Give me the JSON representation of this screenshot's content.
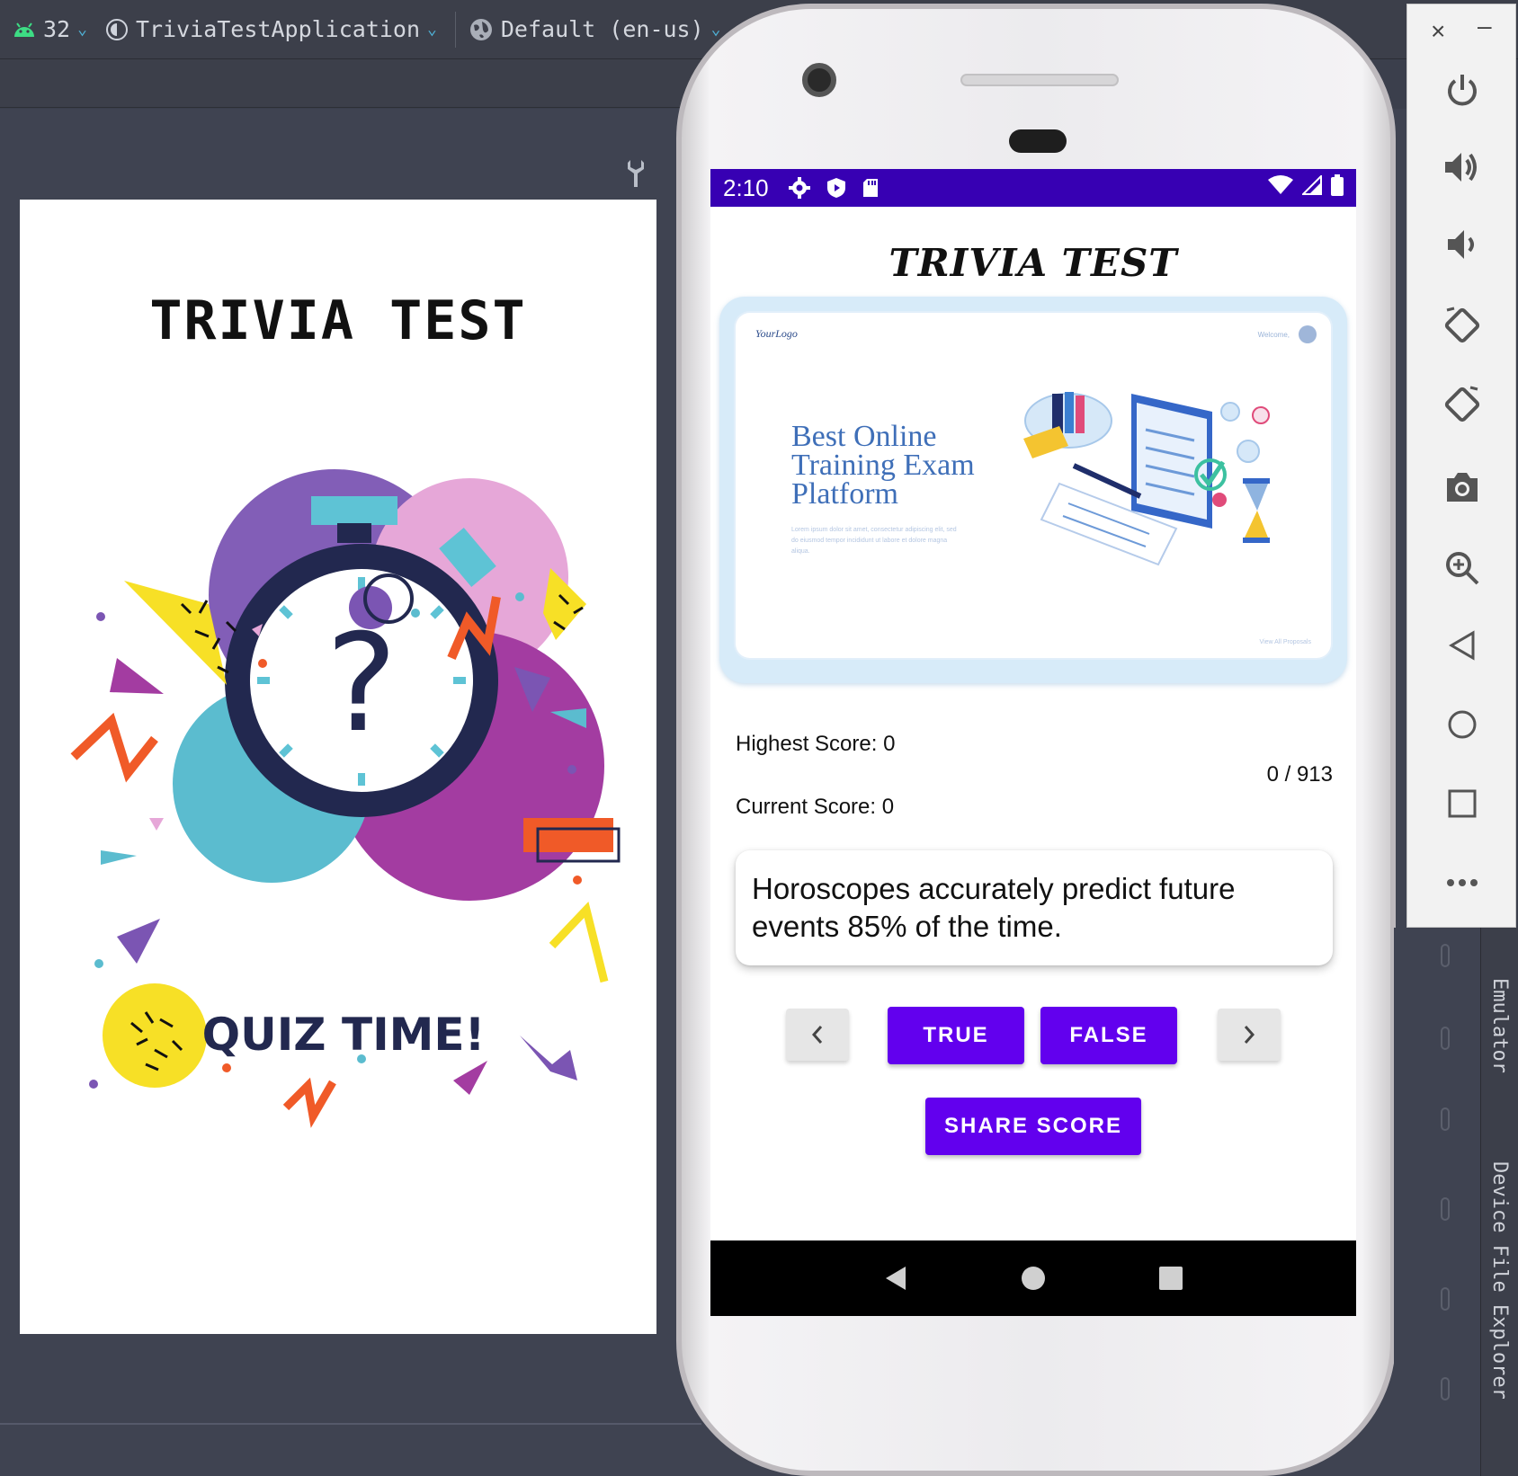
{
  "ide": {
    "api_level": "32",
    "app_config": "TriviaTestApplication",
    "locale": "Default (en-us)"
  },
  "preview": {
    "title": "TRIVIA TEST",
    "quiz_label": "QUIZ TIME!",
    "question_mark": "?"
  },
  "statusbar": {
    "time": "2:10"
  },
  "app": {
    "title": "TRIVIA TEST",
    "banner": {
      "logo": "YourLogo",
      "welcome": "Welcome,",
      "headline": "Best Online Training Exam Platform",
      "lorem": "Lorem ipsum dolor sit amet, consectetur adipiscing elit, sed do eiusmod tempor incididunt ut labore et dolore magna aliqua.",
      "footer": "View All Proposals"
    },
    "highest_score": "Highest Score: 0",
    "current_score": "Current Score: 0",
    "question_count": "0 / 913",
    "question_text": "Horoscopes accurately predict future events 85% of the time.",
    "btn_true": "TRUE",
    "btn_false": "FALSE",
    "btn_share": "SHARE SCORE"
  },
  "side_panels": {
    "emulator": "Emulator",
    "device_file_explorer": "Device File Explorer"
  },
  "colors": {
    "primary": "#6200ee",
    "status_bar": "#3700b3",
    "ide_bg": "#3f4351"
  }
}
